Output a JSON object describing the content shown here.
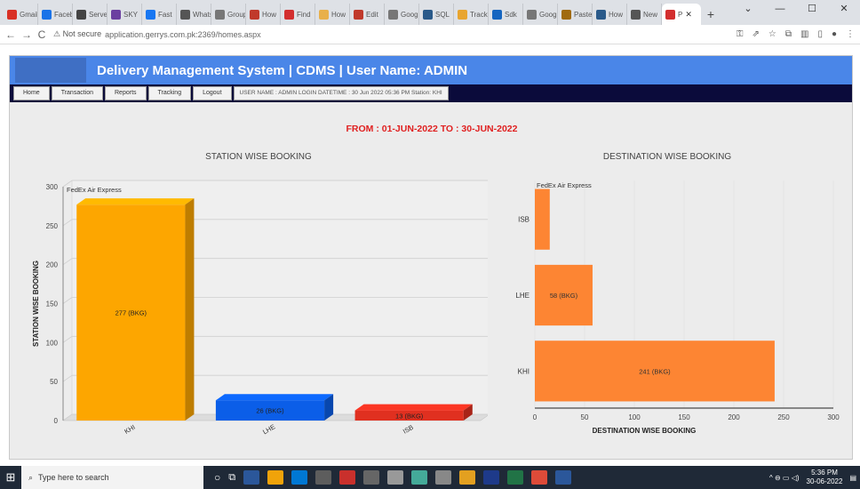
{
  "browser": {
    "tabs": [
      {
        "label": "Gmail",
        "color": "#d93025"
      },
      {
        "label": "Facebook",
        "color": "#1a73e8"
      },
      {
        "label": "Server",
        "color": "#444"
      },
      {
        "label": "SKY",
        "color": "#6b3fa0"
      },
      {
        "label": "Fast",
        "color": "#1877f2"
      },
      {
        "label": "WhatsApp",
        "color": "#555"
      },
      {
        "label": "Group",
        "color": "#777"
      },
      {
        "label": "How",
        "color": "#c0392b"
      },
      {
        "label": "Find",
        "color": "#d32f2f"
      },
      {
        "label": "How",
        "color": "#e8b04a"
      },
      {
        "label": "Edit",
        "color": "#c0392b"
      },
      {
        "label": "Google",
        "color": "#777"
      },
      {
        "label": "SQL",
        "color": "#2a5a8a"
      },
      {
        "label": "Track",
        "color": "#e8a530"
      },
      {
        "label": "Sdk",
        "color": "#1565c0"
      },
      {
        "label": "Google",
        "color": "#777"
      },
      {
        "label": "Paste",
        "color": "#a06a10"
      },
      {
        "label": "How",
        "color": "#2a5a8a"
      },
      {
        "label": "New",
        "color": "#555"
      }
    ],
    "active_tab": {
      "label": "P",
      "close": "✕",
      "color": "#d32f2f"
    },
    "new_tab": "+",
    "window_controls": {
      "minimize": "⌄",
      "restore": "—",
      "maximize": "☐",
      "close": "✕"
    },
    "nav": {
      "back": "←",
      "forward": "→",
      "reload": "C"
    },
    "security": "⚠ Not secure",
    "url": "application.gerrys.com.pk:2369/homes.aspx"
  },
  "app": {
    "title": "Delivery Management System | CDMS | User Name: ADMIN",
    "menu": [
      "Home",
      "Transaction",
      "Reports",
      "Tracking",
      "Logout"
    ],
    "user_info": "USER NAME : ADMIN LOGIN DATETIME : 30 Jun 2022 05:36 PM Station: KHI",
    "date_range": "FROM : 01-JUN-2022 TO : 30-JUN-2022",
    "accent_color": "#4a86e8",
    "menubar_color": "#0b0b3b",
    "range_color": "#e02020"
  },
  "chart_data": [
    {
      "type": "bar",
      "title": "STATION WISE BOOKING",
      "series_label": "FedEx Air Express",
      "ylabel": "STATION WISE BOOKING",
      "xlabel": "",
      "categories": [
        "KHI",
        "LHE",
        "ISB"
      ],
      "values": [
        277,
        26,
        13
      ],
      "data_labels": [
        "277 (BKG)",
        "26 (BKG)",
        "13 (BKG)"
      ],
      "colors": [
        "#fda600",
        "#0b5ee8",
        "#e03020"
      ],
      "ylim": [
        0,
        300
      ],
      "yticks": [
        "0",
        "50",
        "100",
        "150",
        "200",
        "250",
        "300"
      ]
    },
    {
      "type": "bar",
      "orientation": "horizontal",
      "title": "DESTINATION WISE BOOKING",
      "series_label": "FedEx Air Express",
      "xlabel": "DESTINATION WISE BOOKING",
      "categories": [
        "ISB",
        "LHE",
        "KHI"
      ],
      "values": [
        15,
        58,
        241
      ],
      "data_labels": [
        "",
        "58 (BKG)",
        "241 (BKG)"
      ],
      "color": "#fd8533",
      "xlim": [
        0,
        300
      ],
      "xticks": [
        "0",
        "50",
        "100",
        "150",
        "200",
        "250",
        "300"
      ]
    }
  ],
  "taskbar": {
    "start": "⊞",
    "search_placeholder": "Type here to search",
    "search_icon": "magnifier",
    "apps": [
      "#2b579a",
      "#f0a30a",
      "#0078d4",
      "#5d5d5d",
      "#c9302c",
      "#666",
      "#999",
      "#4a9",
      "#888",
      "#e3a020",
      "#1e3a8a",
      "#217346",
      "#dd4b39",
      "#2b579a"
    ],
    "clock_time": "5:36 PM",
    "clock_date": "30-06-2022",
    "tray": "^ ⊖ ▭ ◁)"
  }
}
